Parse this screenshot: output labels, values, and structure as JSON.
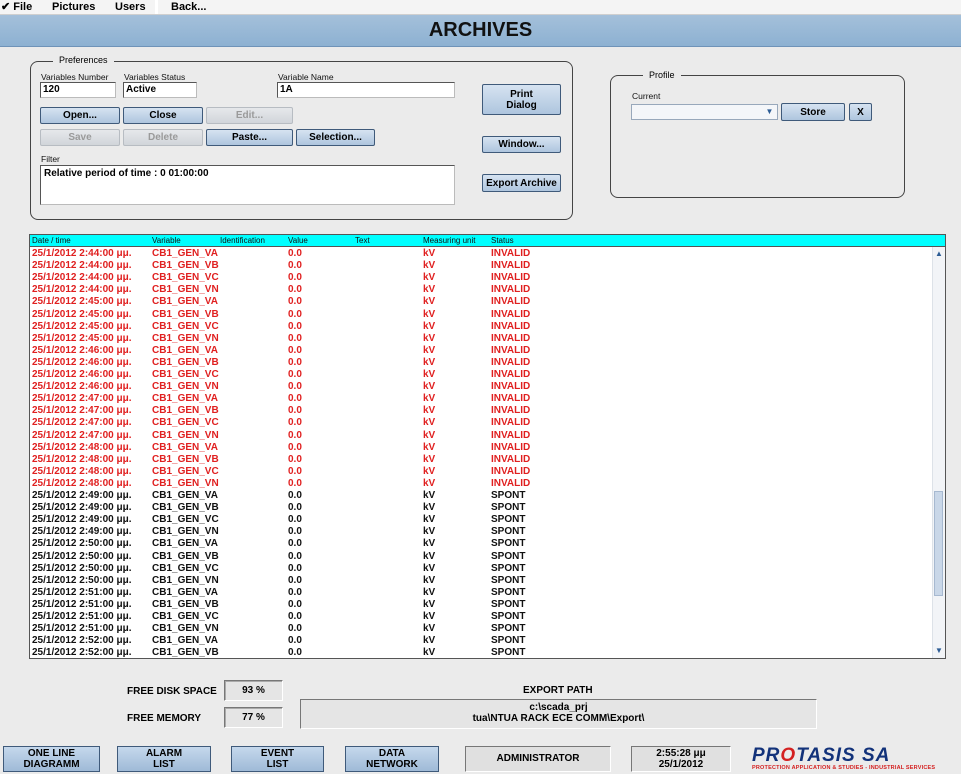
{
  "menubar": {
    "file": "✔ File",
    "pictures": "Pictures",
    "users": "Users",
    "back": "Back..."
  },
  "title": "ARCHIVES",
  "preferences": {
    "legend": "Preferences",
    "variables_number_label": "Variables Number",
    "variables_number_value": "120",
    "variables_status_label": "Variables Status",
    "variables_status_value": "Active",
    "variable_name_label": "Variable Name",
    "variable_name_value": "1A",
    "buttons": {
      "open": "Open...",
      "close": "Close",
      "edit": "Edit...",
      "save": "Save",
      "delete": "Delete",
      "paste": "Paste...",
      "selection": "Selection...",
      "print_line1": "Print",
      "print_line2": "Dialog",
      "window": "Window...",
      "export_archive": "Export Archive"
    },
    "filter_label": "Filter",
    "filter_value": "Relative period of time : 0  01:00:00"
  },
  "profile": {
    "legend": "Profile",
    "current_label": "Current",
    "current_value": "",
    "store": "Store",
    "x": "X"
  },
  "table": {
    "columns": [
      "Date / time",
      "Variable",
      "Identification",
      "Value",
      "Text",
      "Measuring unit",
      "Status"
    ],
    "rows": [
      [
        "25/1/2012 2:44:00 μμ.",
        "CB1_GEN_VA",
        "0.0",
        "kV",
        "INVALID"
      ],
      [
        "25/1/2012 2:44:00 μμ.",
        "CB1_GEN_VB",
        "0.0",
        "kV",
        "INVALID"
      ],
      [
        "25/1/2012 2:44:00 μμ.",
        "CB1_GEN_VC",
        "0.0",
        "kV",
        "INVALID"
      ],
      [
        "25/1/2012 2:44:00 μμ.",
        "CB1_GEN_VN",
        "0.0",
        "kV",
        "INVALID"
      ],
      [
        "25/1/2012 2:45:00 μμ.",
        "CB1_GEN_VA",
        "0.0",
        "kV",
        "INVALID"
      ],
      [
        "25/1/2012 2:45:00 μμ.",
        "CB1_GEN_VB",
        "0.0",
        "kV",
        "INVALID"
      ],
      [
        "25/1/2012 2:45:00 μμ.",
        "CB1_GEN_VC",
        "0.0",
        "kV",
        "INVALID"
      ],
      [
        "25/1/2012 2:45:00 μμ.",
        "CB1_GEN_VN",
        "0.0",
        "kV",
        "INVALID"
      ],
      [
        "25/1/2012 2:46:00 μμ.",
        "CB1_GEN_VA",
        "0.0",
        "kV",
        "INVALID"
      ],
      [
        "25/1/2012 2:46:00 μμ.",
        "CB1_GEN_VB",
        "0.0",
        "kV",
        "INVALID"
      ],
      [
        "25/1/2012 2:46:00 μμ.",
        "CB1_GEN_VC",
        "0.0",
        "kV",
        "INVALID"
      ],
      [
        "25/1/2012 2:46:00 μμ.",
        "CB1_GEN_VN",
        "0.0",
        "kV",
        "INVALID"
      ],
      [
        "25/1/2012 2:47:00 μμ.",
        "CB1_GEN_VA",
        "0.0",
        "kV",
        "INVALID"
      ],
      [
        "25/1/2012 2:47:00 μμ.",
        "CB1_GEN_VB",
        "0.0",
        "kV",
        "INVALID"
      ],
      [
        "25/1/2012 2:47:00 μμ.",
        "CB1_GEN_VC",
        "0.0",
        "kV",
        "INVALID"
      ],
      [
        "25/1/2012 2:47:00 μμ.",
        "CB1_GEN_VN",
        "0.0",
        "kV",
        "INVALID"
      ],
      [
        "25/1/2012 2:48:00 μμ.",
        "CB1_GEN_VA",
        "0.0",
        "kV",
        "INVALID"
      ],
      [
        "25/1/2012 2:48:00 μμ.",
        "CB1_GEN_VB",
        "0.0",
        "kV",
        "INVALID"
      ],
      [
        "25/1/2012 2:48:00 μμ.",
        "CB1_GEN_VC",
        "0.0",
        "kV",
        "INVALID"
      ],
      [
        "25/1/2012 2:48:00 μμ.",
        "CB1_GEN_VN",
        "0.0",
        "kV",
        "INVALID"
      ],
      [
        "25/1/2012 2:49:00 μμ.",
        "CB1_GEN_VA",
        "0.0",
        "kV",
        "SPONT"
      ],
      [
        "25/1/2012 2:49:00 μμ.",
        "CB1_GEN_VB",
        "0.0",
        "kV",
        "SPONT"
      ],
      [
        "25/1/2012 2:49:00 μμ.",
        "CB1_GEN_VC",
        "0.0",
        "kV",
        "SPONT"
      ],
      [
        "25/1/2012 2:49:00 μμ.",
        "CB1_GEN_VN",
        "0.0",
        "kV",
        "SPONT"
      ],
      [
        "25/1/2012 2:50:00 μμ.",
        "CB1_GEN_VA",
        "0.0",
        "kV",
        "SPONT"
      ],
      [
        "25/1/2012 2:50:00 μμ.",
        "CB1_GEN_VB",
        "0.0",
        "kV",
        "SPONT"
      ],
      [
        "25/1/2012 2:50:00 μμ.",
        "CB1_GEN_VC",
        "0.0",
        "kV",
        "SPONT"
      ],
      [
        "25/1/2012 2:50:00 μμ.",
        "CB1_GEN_VN",
        "0.0",
        "kV",
        "SPONT"
      ],
      [
        "25/1/2012 2:51:00 μμ.",
        "CB1_GEN_VA",
        "0.0",
        "kV",
        "SPONT"
      ],
      [
        "25/1/2012 2:51:00 μμ.",
        "CB1_GEN_VB",
        "0.0",
        "kV",
        "SPONT"
      ],
      [
        "25/1/2012 2:51:00 μμ.",
        "CB1_GEN_VC",
        "0.0",
        "kV",
        "SPONT"
      ],
      [
        "25/1/2012 2:51:00 μμ.",
        "CB1_GEN_VN",
        "0.0",
        "kV",
        "SPONT"
      ],
      [
        "25/1/2012 2:52:00 μμ.",
        "CB1_GEN_VA",
        "0.0",
        "kV",
        "SPONT"
      ],
      [
        "25/1/2012 2:52:00 μμ.",
        "CB1_GEN_VB",
        "0.0",
        "kV",
        "SPONT"
      ]
    ],
    "status_colors": {
      "INVALID": "#e02020",
      "SPONT": "#111111"
    },
    "header_color": "#00ffff"
  },
  "footer": {
    "free_disk_label": "FREE DISK SPACE",
    "free_disk_value": "93 %",
    "free_memory_label": "FREE MEMORY",
    "free_memory_value": "77 %",
    "export_path_label": "EXPORT PATH",
    "export_path_line1": "c:\\scada_prj",
    "export_path_line2": "tua\\NTUA  RACK  ECE  COMM\\Export\\"
  },
  "nav": {
    "one_line_1": "ONE LINE",
    "one_line_2": "DIAGRAMM",
    "alarm_1": "ALARM",
    "alarm_2": "LIST",
    "event_1": "EVENT",
    "event_2": "LIST",
    "data_1": "DATA",
    "data_2": "NETWORK",
    "user": "ADMINISTRATOR",
    "time": "2:55:28 μμ",
    "date": "25/1/2012"
  },
  "logo": {
    "part1": "PR",
    "accent": "O",
    "part2": "TASIS SA",
    "subtitle": "PROTECTION APPLICATION & STUDIES - INDUSTRIAL SERVICES"
  }
}
